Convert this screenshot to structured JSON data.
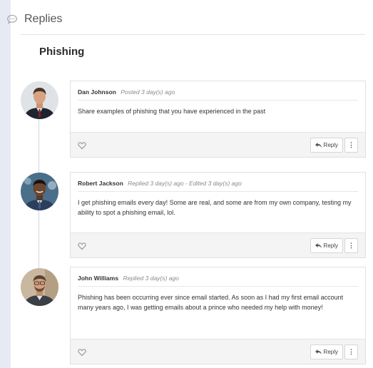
{
  "header": {
    "title": "Replies",
    "icon": "speech-bubble-icon"
  },
  "topic": {
    "title": "Phishing"
  },
  "posts": [
    {
      "author": "Dan Johnson",
      "stamp": "Posted 3 day(s) ago",
      "message": "Share examples of phishing that you have experienced in the past",
      "reply_label": "Reply",
      "more_label": "⋮"
    },
    {
      "author": "Robert Jackson",
      "stamp": "Replied 3 day(s) ago - Edited 3 day(s) ago",
      "message": "I get phishing emails every day!  Some are real, and some are from my own company, testing my ability to spot a phishing email, lol.",
      "reply_label": "Reply",
      "more_label": "⋮"
    },
    {
      "author": "John Williams",
      "stamp": "Replied 3 day(s) ago",
      "message": "Phishing has been occurring ever since email started. As soon as I had my first email account many years ago, I was getting emails about a prince who needed my help with money!",
      "reply_label": "Reply",
      "more_label": "⋮"
    }
  ],
  "colors": {
    "sidebar": "#e5eaf3",
    "footer": "#f4f4f4",
    "thread_line": "#cfd6df"
  }
}
